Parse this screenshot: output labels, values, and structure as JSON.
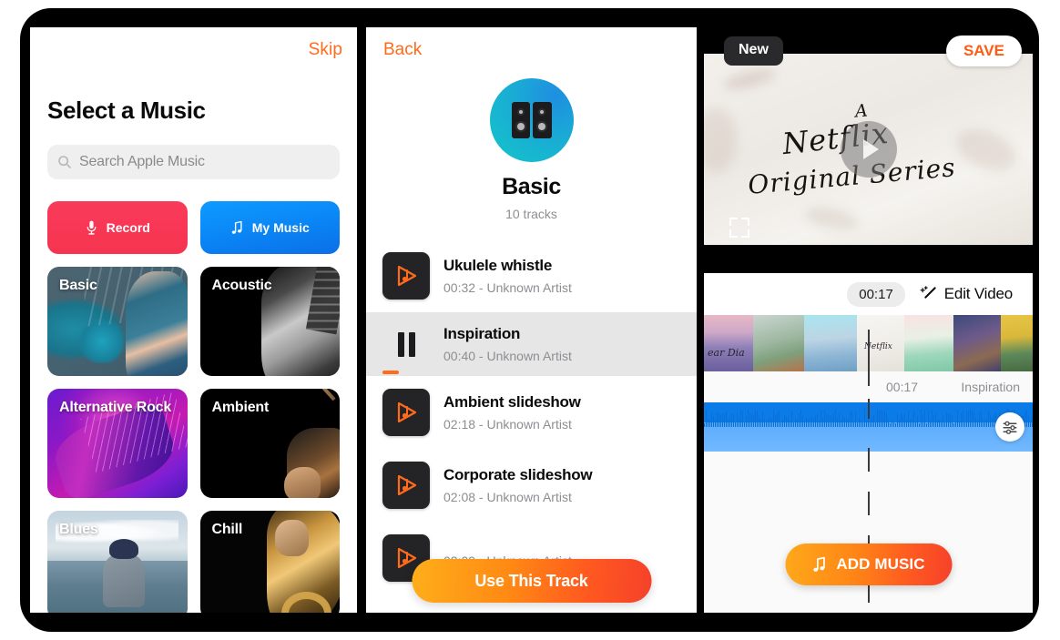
{
  "left_screen": {
    "skip_label": "Skip",
    "title": "Select a Music",
    "search": {
      "placeholder": "Search Apple Music",
      "icon": "search-icon"
    },
    "actions": [
      {
        "label": "Record",
        "icon": "microphone-icon",
        "color": "#F93A5A"
      },
      {
        "label": "My Music",
        "icon": "music-note-icon",
        "color": "#0A84F5"
      }
    ],
    "genres": [
      {
        "label": "Basic"
      },
      {
        "label": "Acoustic"
      },
      {
        "label": "Alternative Rock"
      },
      {
        "label": "Ambient"
      },
      {
        "label": "Blues"
      },
      {
        "label": "Chill"
      }
    ]
  },
  "mid_screen": {
    "back_label": "Back",
    "album": {
      "title": "Basic",
      "subtitle": "10 tracks",
      "icon": "speakers-icon"
    },
    "tracks": [
      {
        "name": "Ukulele whistle",
        "meta": "00:32 - Unknown Artist",
        "state": "idle"
      },
      {
        "name": "Inspiration",
        "meta": "00:40 - Unknown Artist",
        "state": "playing"
      },
      {
        "name": "Ambient slideshow",
        "meta": "02:18 - Unknown Artist",
        "state": "idle"
      },
      {
        "name": "Corporate slideshow",
        "meta": "02:08 - Unknown Artist",
        "state": "idle"
      },
      {
        "name": "",
        "meta": "02:09 - Unknown Artist",
        "state": "idle"
      }
    ],
    "use_track_label": "Use This Track"
  },
  "right_screen": {
    "new_badge": "New",
    "save_label": "SAVE",
    "video": {
      "overlay_text_line1": "A",
      "overlay_text_line2": "Netflix",
      "overlay_text_line3": "Original Series",
      "play_icon": "play-icon",
      "crop_icon": "crop-handle-icon"
    },
    "toolbar": {
      "timecode": "00:17",
      "edit_label": "Edit Video",
      "edit_icon": "magic-wand-icon"
    },
    "timeline": {
      "playhead_time": "00:17",
      "audio_track_name": "Inspiration",
      "mixer_icon": "sliders-icon",
      "frames": [
        {
          "caption": "ear Dia",
          "c1": "#cfa9c8",
          "c2": "#8d7fb8",
          "c3": "#6a5f9c"
        },
        {
          "caption": "",
          "c1": "#c9d6cf",
          "c2": "#7fa07c",
          "c3": "#b5724a"
        },
        {
          "caption": "",
          "c1": "#a8e6ef",
          "c2": "#8fb7d6",
          "c3": "#6f9fc4"
        },
        {
          "caption": "Netflix",
          "c1": "#f4f2ee",
          "c2": "#eceae5",
          "c3": "#e4e1da"
        },
        {
          "caption": "",
          "c1": "#f6d9d9",
          "c2": "#9fd8bb",
          "c3": "#7ec8a8"
        },
        {
          "caption": "",
          "c1": "#3a4a7a",
          "c2": "#8b6a52",
          "c3": "#6d5a8a"
        },
        {
          "caption": "",
          "c1": "#e8c544",
          "c2": "#5d8a5a",
          "c3": "#d8b83c"
        }
      ]
    },
    "add_music_label": "ADD MUSIC",
    "add_music_icon": "music-note-icon"
  }
}
